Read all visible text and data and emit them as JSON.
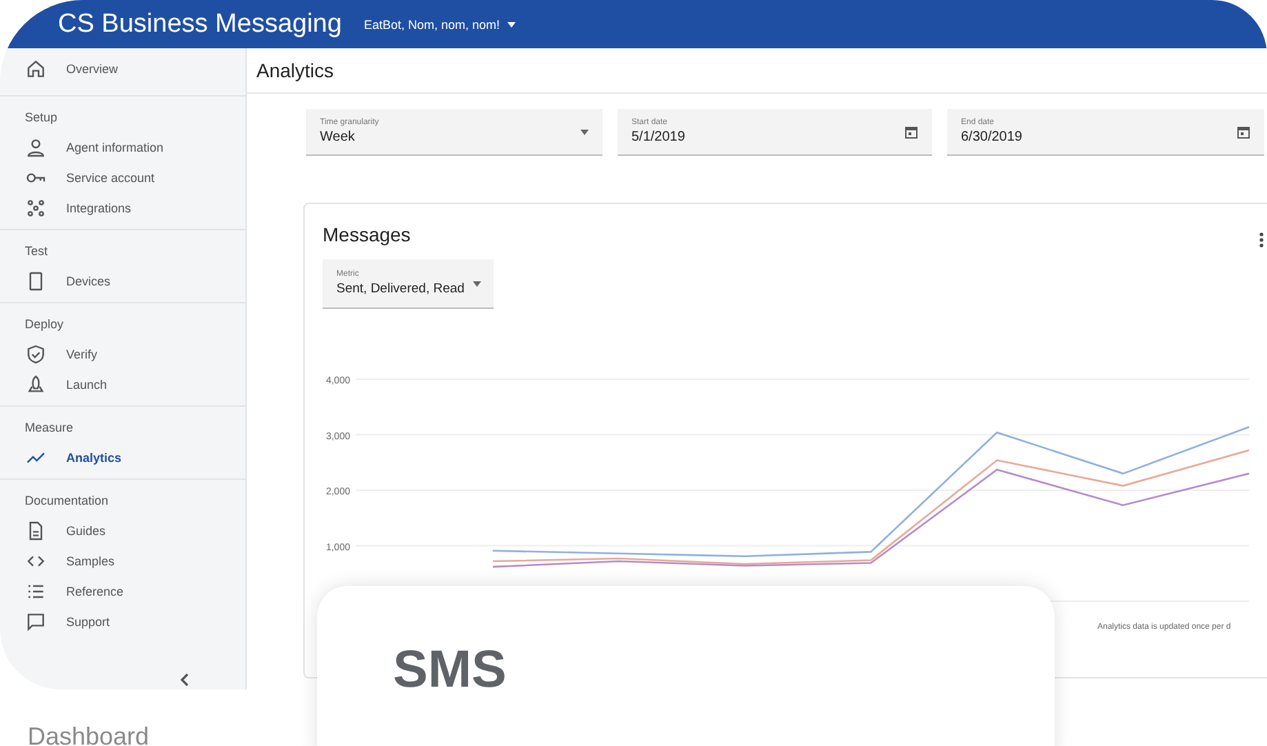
{
  "topbar": {
    "title": "CS Business Messaging",
    "account": "EatBot, Nom, nom, nom!"
  },
  "sidebar": {
    "top": [
      {
        "label": "Overview",
        "selected": false
      }
    ],
    "sections": [
      {
        "heading": "Setup",
        "items": [
          {
            "label": "Agent information",
            "selected": false
          },
          {
            "label": "Service account",
            "selected": false
          },
          {
            "label": "Integrations",
            "selected": false
          }
        ]
      },
      {
        "heading": "Test",
        "items": [
          {
            "label": "Devices",
            "selected": false
          }
        ]
      },
      {
        "heading": "Deploy",
        "items": [
          {
            "label": "Verify",
            "selected": false
          },
          {
            "label": "Launch",
            "selected": false
          }
        ]
      },
      {
        "heading": "Measure",
        "items": [
          {
            "label": "Analytics",
            "selected": true
          }
        ]
      },
      {
        "heading": "Documentation",
        "items": [
          {
            "label": "Guides",
            "selected": false
          },
          {
            "label": "Samples",
            "selected": false
          },
          {
            "label": "Reference",
            "selected": false
          },
          {
            "label": "Support",
            "selected": false
          }
        ]
      }
    ]
  },
  "main": {
    "title": "Analytics",
    "filters": [
      {
        "kind": "dropdown",
        "label": "Time granularity",
        "value": "Week"
      },
      {
        "kind": "date",
        "label": "Start date",
        "value": "5/1/2019"
      },
      {
        "kind": "date",
        "label": "End date",
        "value": "6/30/2019"
      }
    ],
    "card": {
      "title": "Messages",
      "metric": {
        "label": "Metric",
        "value": "Sent, Delivered, Read"
      },
      "chart_data": {
        "type": "line",
        "grid": true,
        "ylim": [
          0,
          4000
        ],
        "yticks": [
          {
            "value": 1000,
            "label": "1,000"
          },
          {
            "value": 2000,
            "label": "2,000"
          },
          {
            "value": 3000,
            "label": "3,000"
          },
          {
            "value": 4000,
            "label": "4,000"
          }
        ],
        "series": [
          {
            "color": "#8fb0e0",
            "values": [
              null,
              910,
              860,
              810,
              890,
              3040,
              2300,
              3140
            ]
          },
          {
            "color": "#e8a898",
            "values": [
              null,
              720,
              770,
              670,
              740,
              2540,
              2080,
              2720
            ]
          },
          {
            "color": "#b48ccc",
            "values": [
              null,
              620,
              720,
              640,
              690,
              2370,
              1730,
              2300
            ]
          }
        ]
      },
      "footnote": "Analytics data is updated once per d"
    }
  },
  "overlay": {
    "title": "SMS"
  },
  "caption": "Dashboard"
}
